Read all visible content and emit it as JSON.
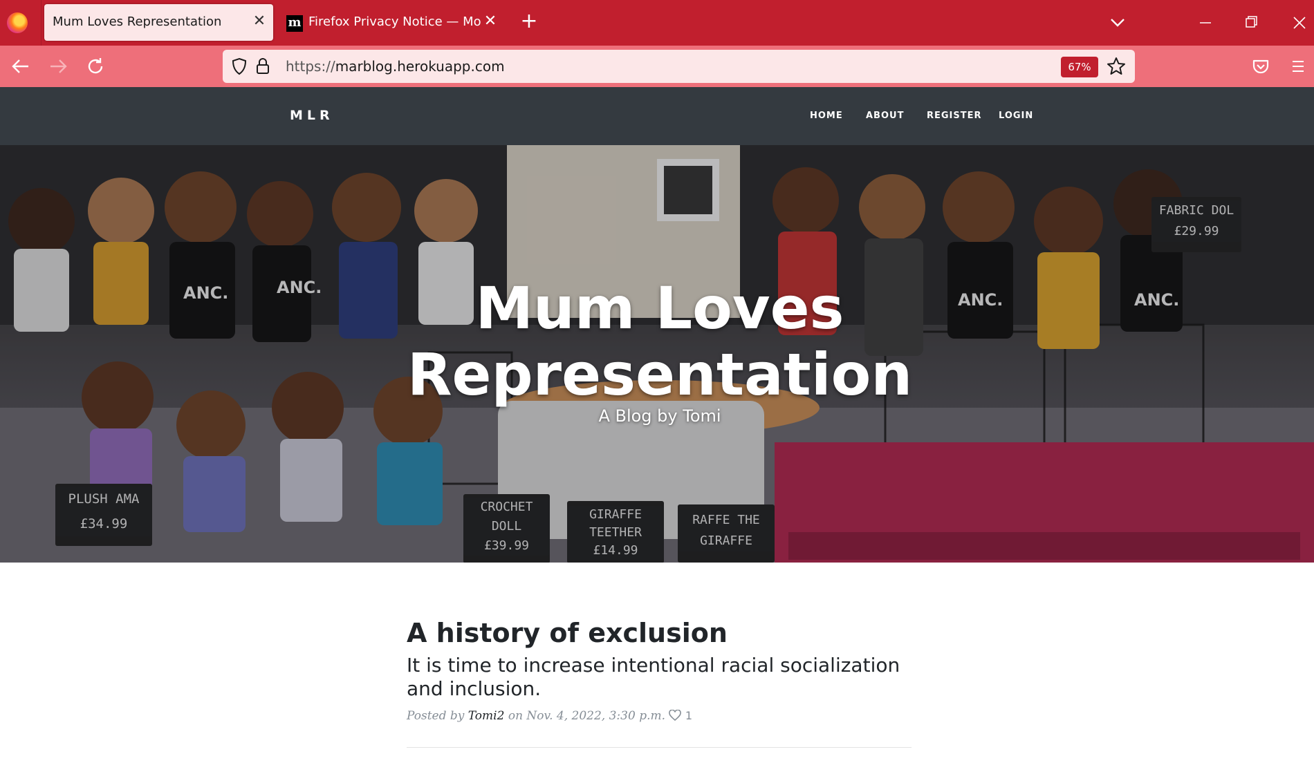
{
  "browser": {
    "tabs": [
      {
        "title": "Mum Loves Representation",
        "active": true
      },
      {
        "title": "Firefox Privacy Notice — Mozilla",
        "active": false
      }
    ],
    "url": {
      "scheme": "https://",
      "host": "marblog.herokuapp.com"
    },
    "zoom": "67%",
    "accent_color": "#c11f2e",
    "toolbar_color": "#ee6f7a"
  },
  "site": {
    "brand": "MLR",
    "nav": [
      "HOME",
      "ABOUT",
      "REGISTER",
      "LOGIN"
    ]
  },
  "hero": {
    "title_line1": "Mum Loves",
    "title_line2": "Representation",
    "subtitle": "A Blog by Tomi",
    "signs": [
      {
        "line1": "FABRIC DOL",
        "line2": "£29.99"
      },
      {
        "line1": "PLUSH AMA",
        "line2": "£34.99"
      },
      {
        "line1": "CROCHET",
        "line2": "DOLL",
        "line3": "£39.99"
      },
      {
        "line1": "GIRAFFE",
        "line2": "TEETHER",
        "line3": "£14.99"
      },
      {
        "line1": "RAFFE THE",
        "line2": "GIRAFFE"
      }
    ],
    "shirt_labels": [
      "ANC.",
      "ANC.",
      "ANC.",
      "ANC."
    ]
  },
  "post": {
    "title": "A history of exclusion",
    "subtitle": "It is time to increase intentional racial socialization and inclusion.",
    "meta_prefix": "Posted by",
    "author": "Tomi2",
    "meta_date": "on Nov. 4, 2022, 3:30 p.m.",
    "likes": "1"
  }
}
